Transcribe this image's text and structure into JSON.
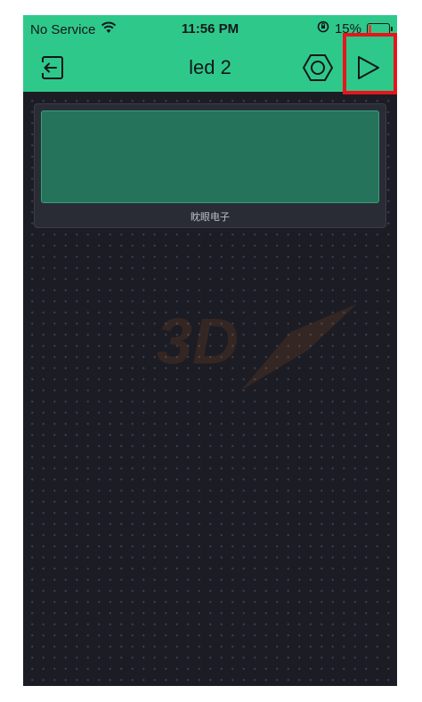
{
  "status_bar": {
    "carrier": "No Service",
    "time": "11:56 PM",
    "battery_percent": "15%",
    "battery_level": 0.15,
    "wifi_icon": "wifi-icon",
    "orientation_lock_icon": "orientation-lock-icon"
  },
  "nav": {
    "title": "led 2",
    "back_icon": "exit-icon",
    "settings_icon": "hexagon-settings-icon",
    "play_icon": "play-icon"
  },
  "widget": {
    "type": "lcd-display",
    "label": "眈眼电子"
  },
  "watermark": {
    "text": "3D",
    "icon": "watermark-logo-icon"
  },
  "colors": {
    "accent": "#2ec98a",
    "background": "#1c1c24",
    "lcd": "#24735a",
    "highlight": "#e8141c",
    "battery_low": "#e53a2f"
  }
}
